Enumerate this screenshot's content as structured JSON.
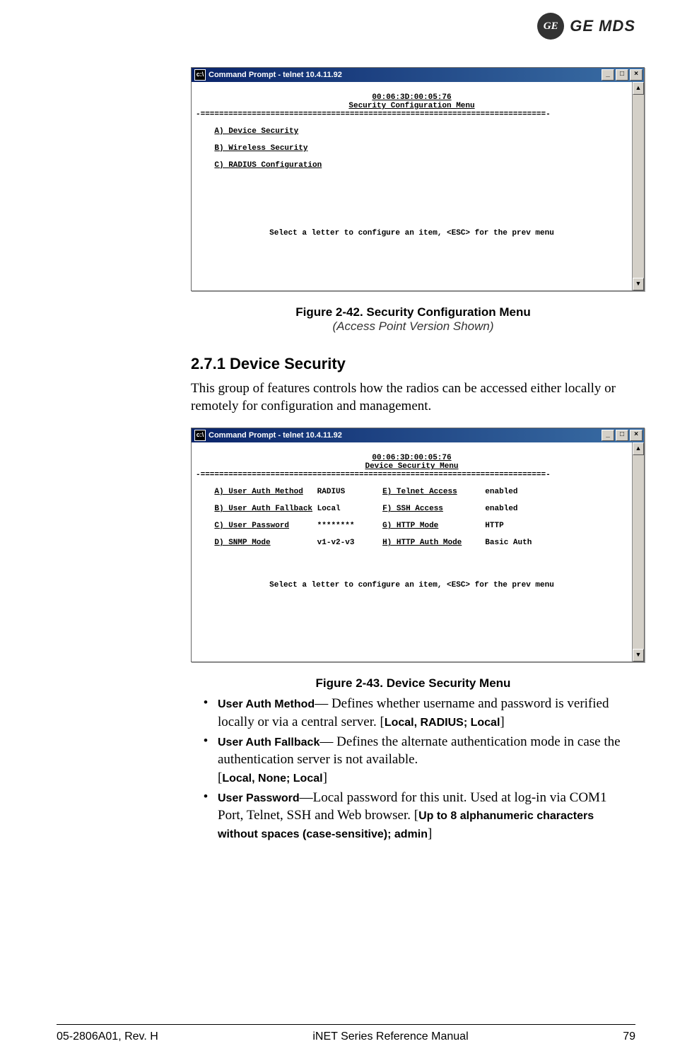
{
  "header": {
    "brand_short": "GE",
    "brand_long": "GE MDS"
  },
  "figure1": {
    "window_title": "Command Prompt - telnet 10.4.11.92",
    "mac": "00:06:3D:00:05:76",
    "menu_title": "Security Configuration Menu",
    "items": {
      "a": "A) Device Security",
      "b": "B) Wireless Security",
      "c": "C) RADIUS Configuration"
    },
    "footer_prompt": "Select a letter to configure an item, <ESC> for the prev menu",
    "caption_title": "Figure 2-42. Security Configuration Menu",
    "caption_sub": "(Access Point Version Shown)"
  },
  "section": {
    "heading": "2.7.1 Device Security",
    "intro": "This group of features controls how the radios can be accessed either locally or remotely for configuration and management."
  },
  "figure2": {
    "window_title": "Command Prompt - telnet 10.4.11.92",
    "mac": "00:06:3D:00:05:76",
    "menu_title": "Device Security Menu",
    "rows": {
      "a_label": "A) User Auth Method",
      "a_val": "RADIUS",
      "e_label": "E) Telnet Access",
      "e_val": "enabled",
      "b_label": "B) User Auth Fallback",
      "b_val": "Local",
      "f_label": "F) SSH Access",
      "f_val": "enabled",
      "c_label": "C) User Password",
      "c_val": "********",
      "g_label": "G) HTTP Mode",
      "g_val": "HTTP",
      "d_label": "D) SNMP Mode",
      "d_val": "v1-v2-v3",
      "h_label": "H) HTTP Auth Mode",
      "h_val": "Basic Auth"
    },
    "footer_prompt": "Select a letter to configure an item, <ESC> for the prev menu",
    "caption_title": "Figure 2-43. Device Security Menu"
  },
  "bullets": {
    "b1_term": "User Auth Method",
    "b1_dash": "— ",
    "b1_text": "Defines whether username and password is verified locally or via a central server. [",
    "b1_opts": "Local, RADIUS; Local",
    "b1_end": "]",
    "b2_term": "User Auth Fallback",
    "b2_dash": "— ",
    "b2_text": "Defines the alternate authentication mode in case the authentication server is not available.",
    "b2_opts_open": "[",
    "b2_opts": "Local, None; Local",
    "b2_opts_close": "]",
    "b3_term": "User Password",
    "b3_dash": "—",
    "b3_text": "Local password for this unit. Used at log-in via COM1 Port, Telnet, SSH and Web browser. [",
    "b3_opts": "Up to 8 alphanumeric characters without spaces (case-sensitive); admin",
    "b3_end": "]"
  },
  "footer": {
    "left": "05-2806A01, Rev. H",
    "center": "iNET Series Reference Manual",
    "right": "79"
  }
}
